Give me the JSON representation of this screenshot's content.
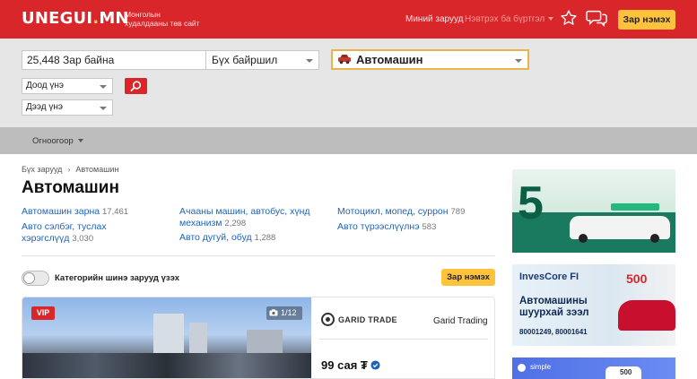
{
  "header": {
    "logo_main": "UNEGUI",
    "logo_dot": ".",
    "logo_tld": "MN",
    "tagline": "Монголын худалдааны төв сайт",
    "my_ads": "Миний зарууд",
    "login": "Нэвтрэх ба бүртгэл",
    "post_ad": "Зар нэмэх",
    "brand_color": "#d8262a",
    "accent_color": "#ffc23d"
  },
  "search": {
    "count_text": "25,448 Зар байна",
    "location": "Бүх байршил",
    "category": "Автомашин",
    "min_price": "Доод үнэ",
    "max_price": "Дээд үнэ"
  },
  "sort": {
    "label": "Огноогоор"
  },
  "breadcrumb": {
    "all": "Бүх зарууд",
    "current": "Автомашин"
  },
  "page_title": "Автомашин",
  "subcategories": [
    {
      "label": "Автомашин зарна",
      "count": "17,461"
    },
    {
      "label": "Ачааны машин, автобус, хүнд механизм",
      "count": "2,298"
    },
    {
      "label": "Мотоцикл, мопед, суррон",
      "count": "789"
    },
    {
      "label": "Авто сэлбэг, туслах хэрэгслүүд",
      "count": "3,030"
    },
    {
      "label": "Авто дугуй, обуд",
      "count": "1,288"
    },
    {
      "label": "Авто түрээслүүлнэ",
      "count": "583"
    }
  ],
  "filter": {
    "toggle_label": "Категорийн шинэ зарууд үзэх",
    "post_ad": "Зар нэмэх"
  },
  "listing": {
    "vip": "VIP",
    "photo_count": "1/12",
    "dealer_brand": "GARID TRADE",
    "dealer_name": "Garid Trading",
    "price": "99 сая ₮"
  },
  "ads": {
    "ad1_number": "5",
    "ad2_brand": "InvesCore FI",
    "ad2_amount": "500",
    "ad2_headline": "Автомашины шуурхай зээл",
    "ad2_phone": "80001249, 80001641",
    "ad3_brand": "simple",
    "ad3_amount": "500"
  }
}
